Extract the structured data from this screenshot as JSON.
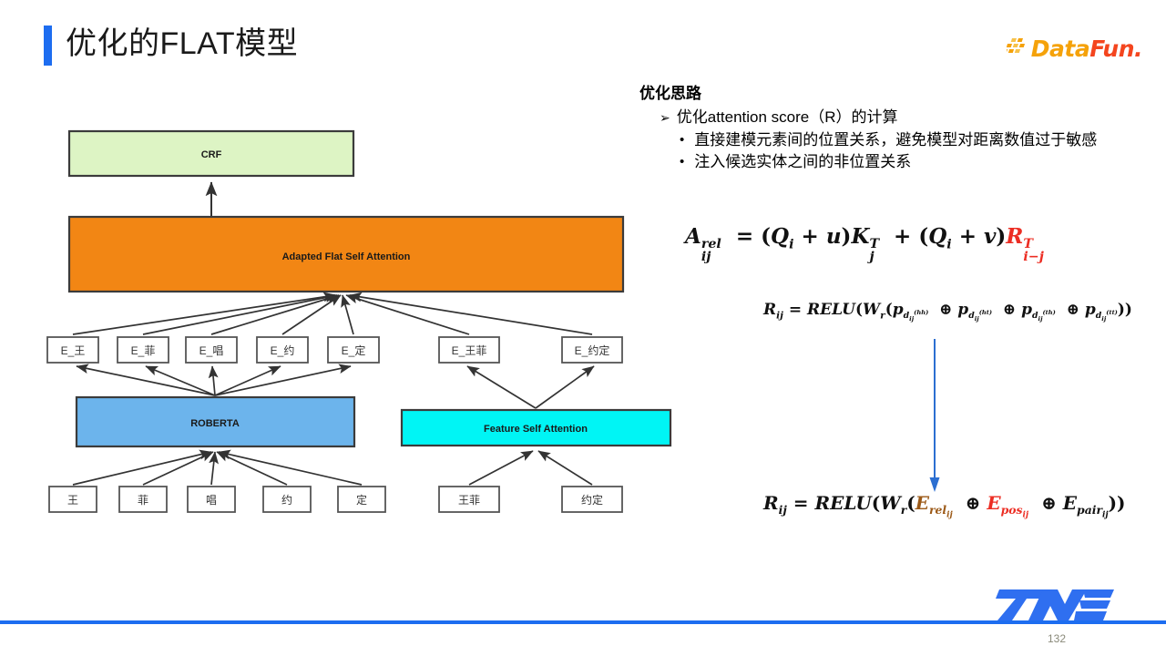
{
  "header": {
    "title": "优化的FLAT模型",
    "accent_color": "#1d6df0",
    "logo": {
      "part1": "Data",
      "part2": "Fun.",
      "part1_color": "#f5a20a",
      "part2_color": "#f4451e"
    }
  },
  "right_panel": {
    "heading": "优化思路",
    "bullet1": {
      "marker": "➢",
      "text": "优化attention score（R）的计算"
    },
    "bullet2": {
      "marker": "•",
      "text": "直接建模元素间的位置关系，避免模型对距离数值过于敏感"
    },
    "bullet3": {
      "marker": "•",
      "text": "注入候选实体之间的非位置关系"
    }
  },
  "formulas": {
    "formula1_plain": "A_ij^rel = (Q_i + u)K_j^T + (Q_i + v)R_{i-j}^T",
    "formula2_plain": "R_ij = RELU(W_r(p_{d_ij^(hh)} ⊕ p_{d_ij^(ht)} ⊕ p_{d_ij^(th)} ⊕ p_{d_ij^(tt)}))",
    "formula3_plain": "R_ij = RELU(W_r(E_rel_ij ⊕ E_pos_ij ⊕ E_pair_ij))",
    "highlight_red": "#ec2d23",
    "highlight_brown": "#9c5a18",
    "arrow_color": "#2c6fd1"
  },
  "diagram": {
    "boxes": {
      "crf": {
        "label": "CRF",
        "fill": "#ddf4c4",
        "stroke": "#3b3b3b"
      },
      "adapted_flat": {
        "label": "Adapted Flat Self Attention",
        "fill": "#f28614",
        "stroke": "#3b3b3b"
      },
      "roberta": {
        "label": "ROBERTA",
        "fill": "#6cb4ec",
        "stroke": "#3b3b3b"
      },
      "feature_self_attention": {
        "label": "Feature Self Attention",
        "fill": "#00f5f5",
        "stroke": "#3b3b3b"
      }
    },
    "embedding_nodes_left": [
      "E_王",
      "E_菲",
      "E_唱",
      "E_约",
      "E_定"
    ],
    "embedding_nodes_right": [
      "E_王菲",
      "E_约定"
    ],
    "token_nodes_left": [
      "王",
      "菲",
      "唱",
      "约",
      "定"
    ],
    "token_nodes_right": [
      "王菲",
      "约定"
    ]
  },
  "footer": {
    "page_number": "132",
    "line_color": "#1d6df0",
    "logo_color": "#2f6ff0"
  }
}
